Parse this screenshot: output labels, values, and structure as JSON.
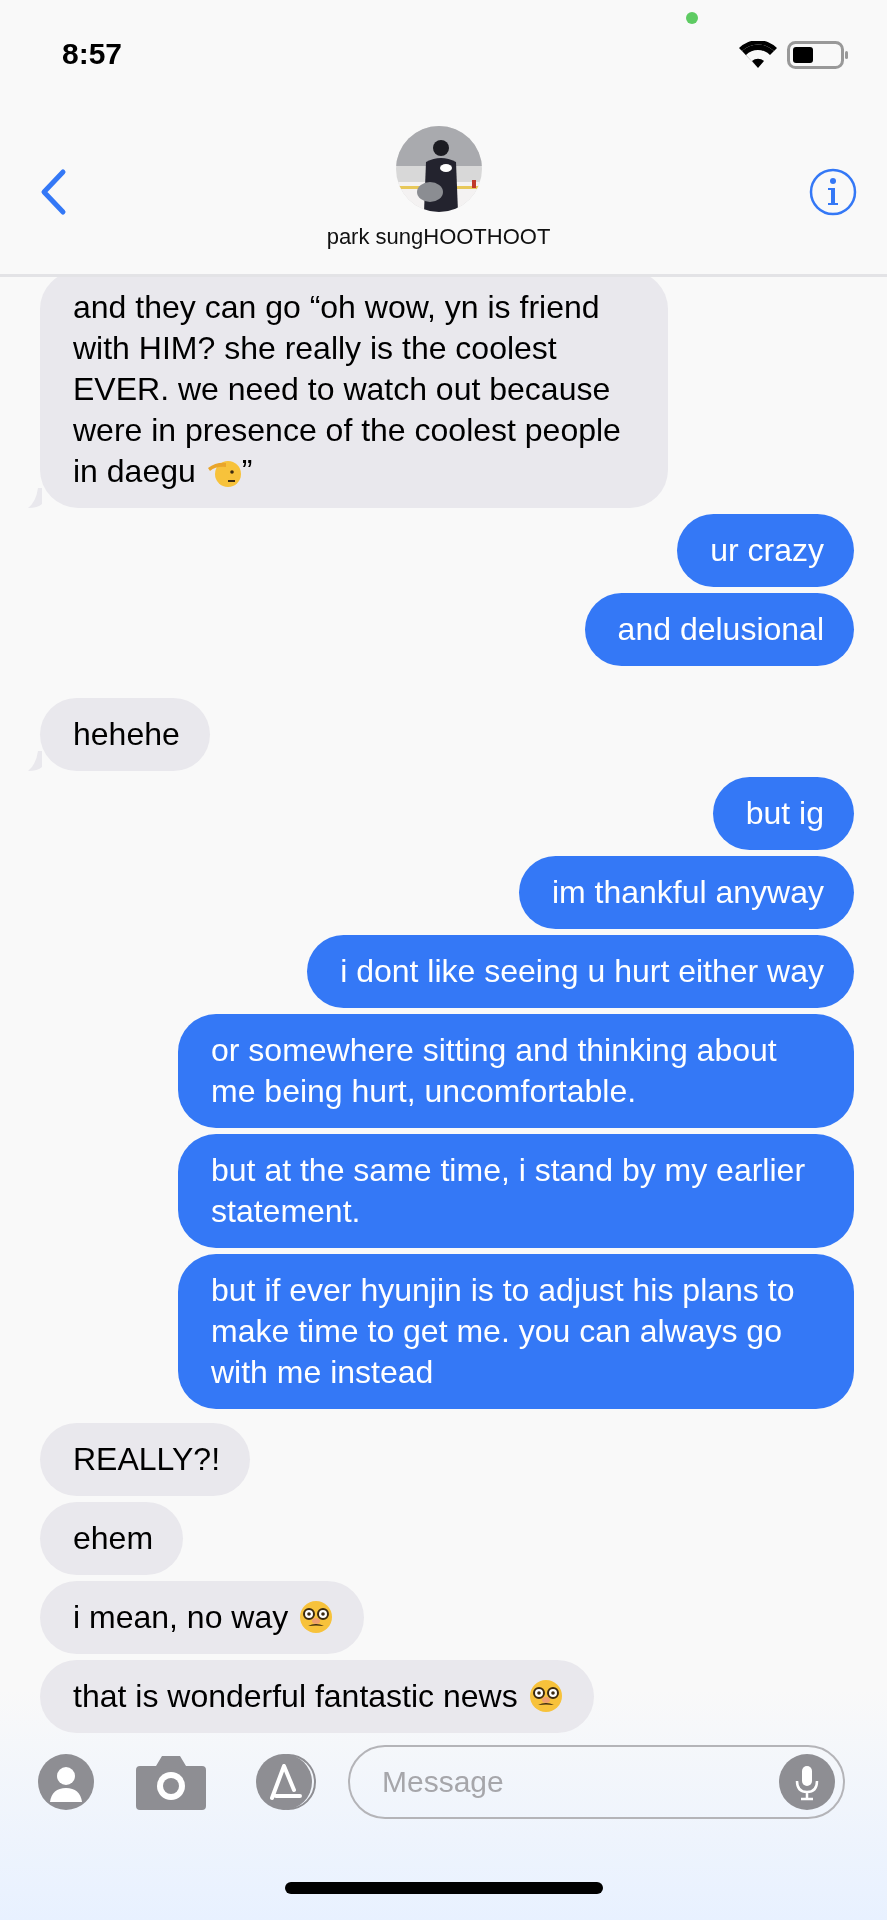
{
  "status_bar": {
    "time": "8:57"
  },
  "header": {
    "contact_name": "park sungHOOTHOOT"
  },
  "messages": [
    {
      "sent": false,
      "text": "and they can go “oh wow, yn is friend with HIM? she really is the coolest EVER. we need to watch out because were in presence of the coolest people",
      "text_end": "in daegu",
      "emoji": {
        "kind": "salute"
      },
      "after": "”",
      "tail": true
    },
    {
      "sent": true,
      "text": "ur crazy",
      "tail": false
    },
    {
      "sent": true,
      "text": "and delusional",
      "tail": false
    },
    {
      "sent": false,
      "text": "hehehe",
      "tail": true
    },
    {
      "sent": true,
      "text": "but ig",
      "tail": false
    },
    {
      "sent": true,
      "text": "im thankful anyway",
      "tail": false
    },
    {
      "sent": true,
      "text": "i dont like seeing u hurt either way",
      "tail": false
    },
    {
      "sent": true,
      "text": "or somewhere sitting and thinking about me being hurt, uncomfortable.",
      "tail": false
    },
    {
      "sent": true,
      "text": "but at the same time, i stand by my earlier statement.",
      "tail": false
    },
    {
      "sent": true,
      "text": "but if ever hyunjin is to adjust his plans to make time to get me. you can always go with me instead",
      "tail": false
    },
    {
      "sent": false,
      "text": "REALLY?!",
      "tail": false
    },
    {
      "sent": false,
      "text": "ehem",
      "tail": false
    },
    {
      "sent": false,
      "text": "i mean, no way",
      "emoji": {
        "kind": "disguise"
      },
      "tail": false
    },
    {
      "sent": false,
      "text": "that is wonderful fantastic news",
      "emoji": {
        "kind": "disguise"
      },
      "tail": false
    }
  ],
  "composer": {
    "placeholder": "Message"
  }
}
